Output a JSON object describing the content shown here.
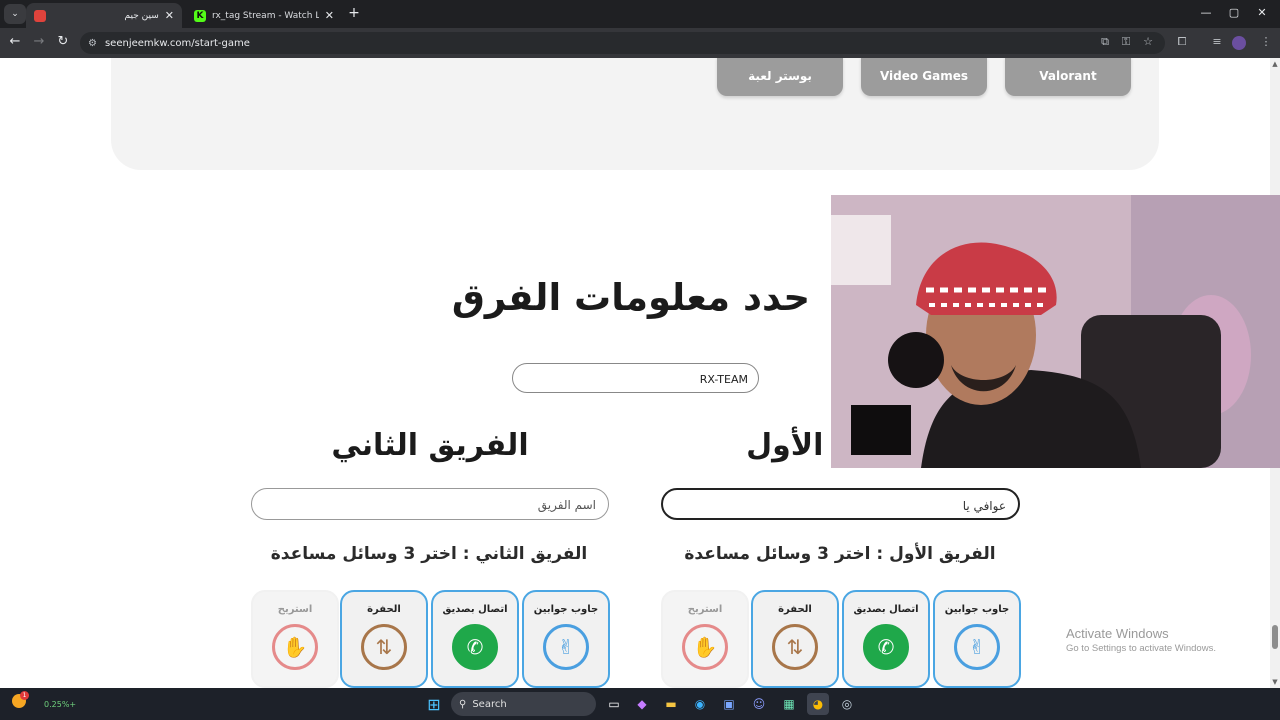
{
  "browser": {
    "tabs": [
      {
        "title": "سين جيم",
        "active": true
      },
      {
        "title": "rx_tag Stream - Watch Live on Kick",
        "active": false
      }
    ],
    "new_tab": "+",
    "url": "seenjeemkw.com/start-game",
    "window_controls": {
      "minimize": "—",
      "maximize": "▢",
      "close": "✕"
    }
  },
  "categories": [
    "بوستر لعبة",
    "Video Games",
    "Valorant"
  ],
  "heading": "حدد معلومات الفرق",
  "game_name_value": "RX-TEAM",
  "team1": {
    "title": "الفريق الأول",
    "name_value": "عوافي يا",
    "help_title": "الفريق الأول : اختر 3 وسائل مساعدة",
    "lifelines": [
      {
        "label": "جاوب جوابين",
        "icon": "peace-hand-icon",
        "glyph": "✌",
        "color": "#4a9fe0",
        "selected": true
      },
      {
        "label": "اتصال بصديق",
        "icon": "phone-icon",
        "glyph": "✆",
        "color": "#1fa84a",
        "selected": true
      },
      {
        "label": "الحفرة",
        "icon": "swap-arrows-icon",
        "glyph": "⇅",
        "color": "#a8764a",
        "selected": true
      },
      {
        "label": "استريح",
        "icon": "stop-hand-icon",
        "glyph": "✋",
        "color": "#e58a8a",
        "selected": false
      }
    ]
  },
  "team2": {
    "title": "الفريق الثاني",
    "name_placeholder": "اسم الفريق",
    "help_title": "الفريق الثاني : اختر 3 وسائل مساعدة",
    "lifelines": [
      {
        "label": "جاوب جوابين",
        "icon": "peace-hand-icon",
        "glyph": "✌",
        "color": "#4a9fe0",
        "selected": true
      },
      {
        "label": "اتصال بصديق",
        "icon": "phone-icon",
        "glyph": "✆",
        "color": "#1fa84a",
        "selected": true
      },
      {
        "label": "الحفرة",
        "icon": "swap-arrows-icon",
        "glyph": "⇅",
        "color": "#a8764a",
        "selected": true
      },
      {
        "label": "استريح",
        "icon": "stop-hand-icon",
        "glyph": "✋",
        "color": "#e58a8a",
        "selected": false
      }
    ]
  },
  "watermark": {
    "title": "Activate Windows",
    "subtitle": "Go to Settings to activate Windows."
  },
  "taskbar": {
    "search_label": "Search",
    "weather_value": "0.25%+",
    "notification_count": "1"
  }
}
